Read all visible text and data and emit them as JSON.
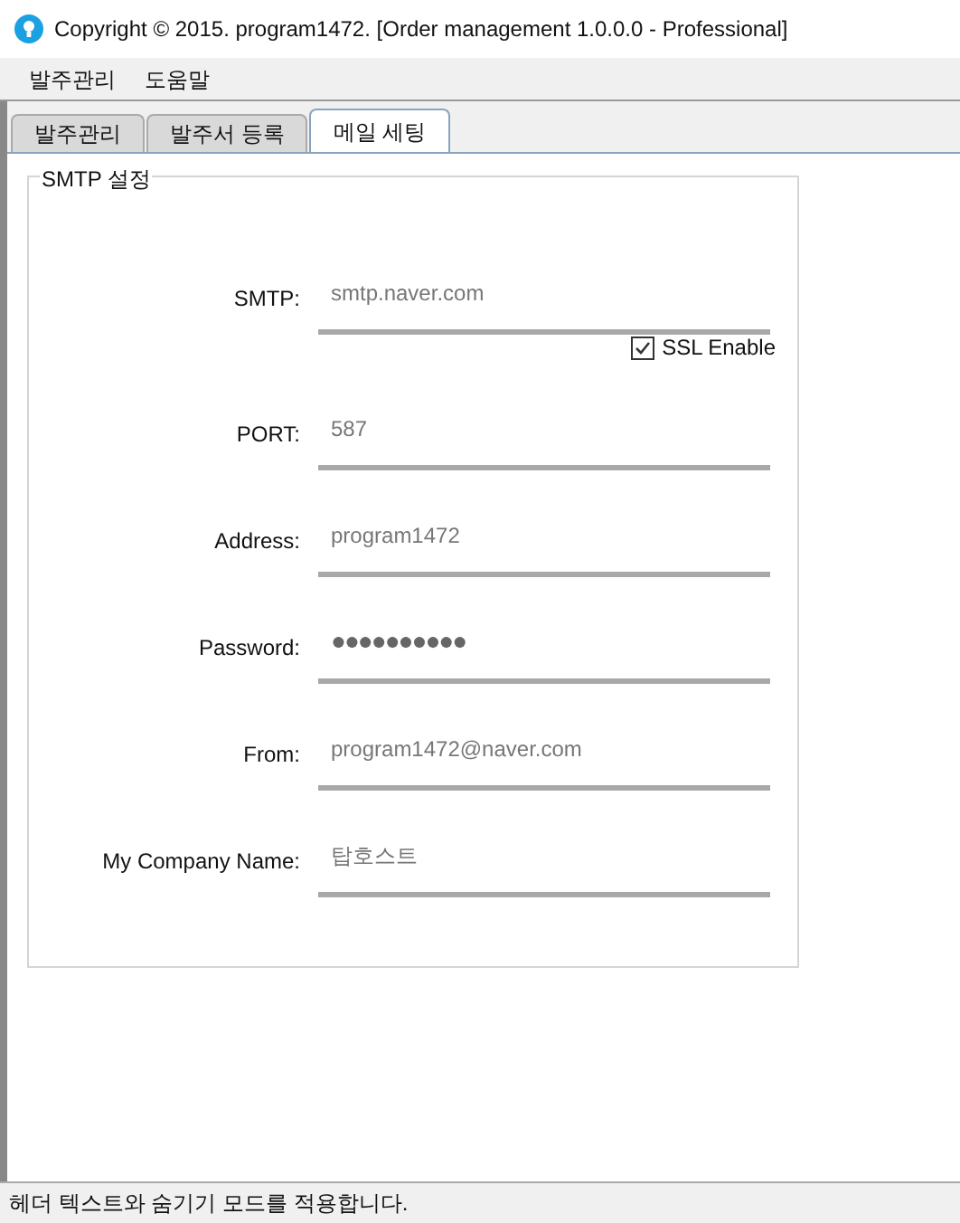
{
  "window": {
    "title": "Copyright © 2015. program1472. [Order management 1.0.0.0 - Professional]"
  },
  "menu": [
    "발주관리",
    "도움말"
  ],
  "tabs": [
    {
      "label": "발주관리",
      "selected": false
    },
    {
      "label": "발주서 등록",
      "selected": false
    },
    {
      "label": "메일 세팅",
      "selected": true
    }
  ],
  "group": {
    "title": "SMTP 설정"
  },
  "fields": [
    {
      "label": "SMTP:",
      "value": "smtp.naver.com",
      "kind": "text"
    },
    {
      "label": "SSL Enable",
      "checked": true,
      "kind": "checkbox"
    },
    {
      "label": "PORT:",
      "value": "587",
      "kind": "text"
    },
    {
      "label": "Address:",
      "value": "program1472",
      "kind": "text"
    },
    {
      "label": "Password:",
      "value": "●●●●●●●●●●",
      "kind": "password"
    },
    {
      "label": "From:",
      "value": "program1472@naver.com",
      "kind": "text"
    },
    {
      "label": "My Company Name:",
      "value": "탑호스트",
      "kind": "text"
    }
  ],
  "status_bar": "헤더 텍스트와 숨기기 모드를 적용합니다."
}
